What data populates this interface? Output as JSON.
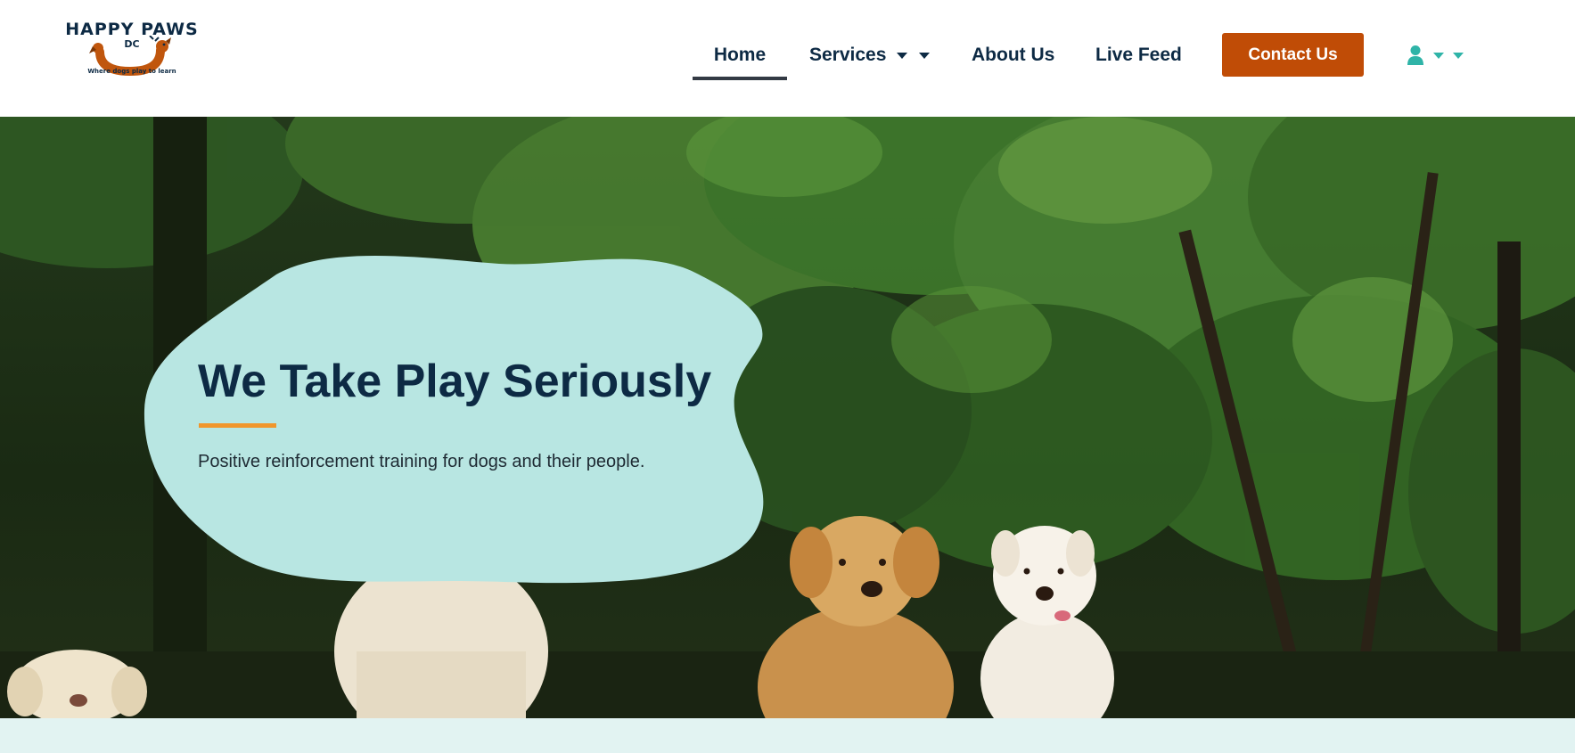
{
  "logo": {
    "title": "HAPPY PAWS",
    "subtitle": "DC",
    "tagline": "Where dogs play to learn"
  },
  "nav": {
    "items": [
      {
        "label": "Home",
        "active": true
      },
      {
        "label": "Services",
        "has_dropdown": true
      },
      {
        "label": "About Us"
      },
      {
        "label": "Live Feed"
      }
    ],
    "contact_label": "Contact Us",
    "account_icon": "user-icon"
  },
  "hero": {
    "title": "We Take Play Seriously",
    "subtitle": "Positive reinforcement training for dogs and their people."
  },
  "colors": {
    "brand_navy": "#0d2a44",
    "contact_button": "#c04c06",
    "accent_orange": "#f0962b",
    "blob_teal": "#b8e6e2",
    "icon_teal": "#2fb4a8",
    "band": "#e2f3f2"
  }
}
